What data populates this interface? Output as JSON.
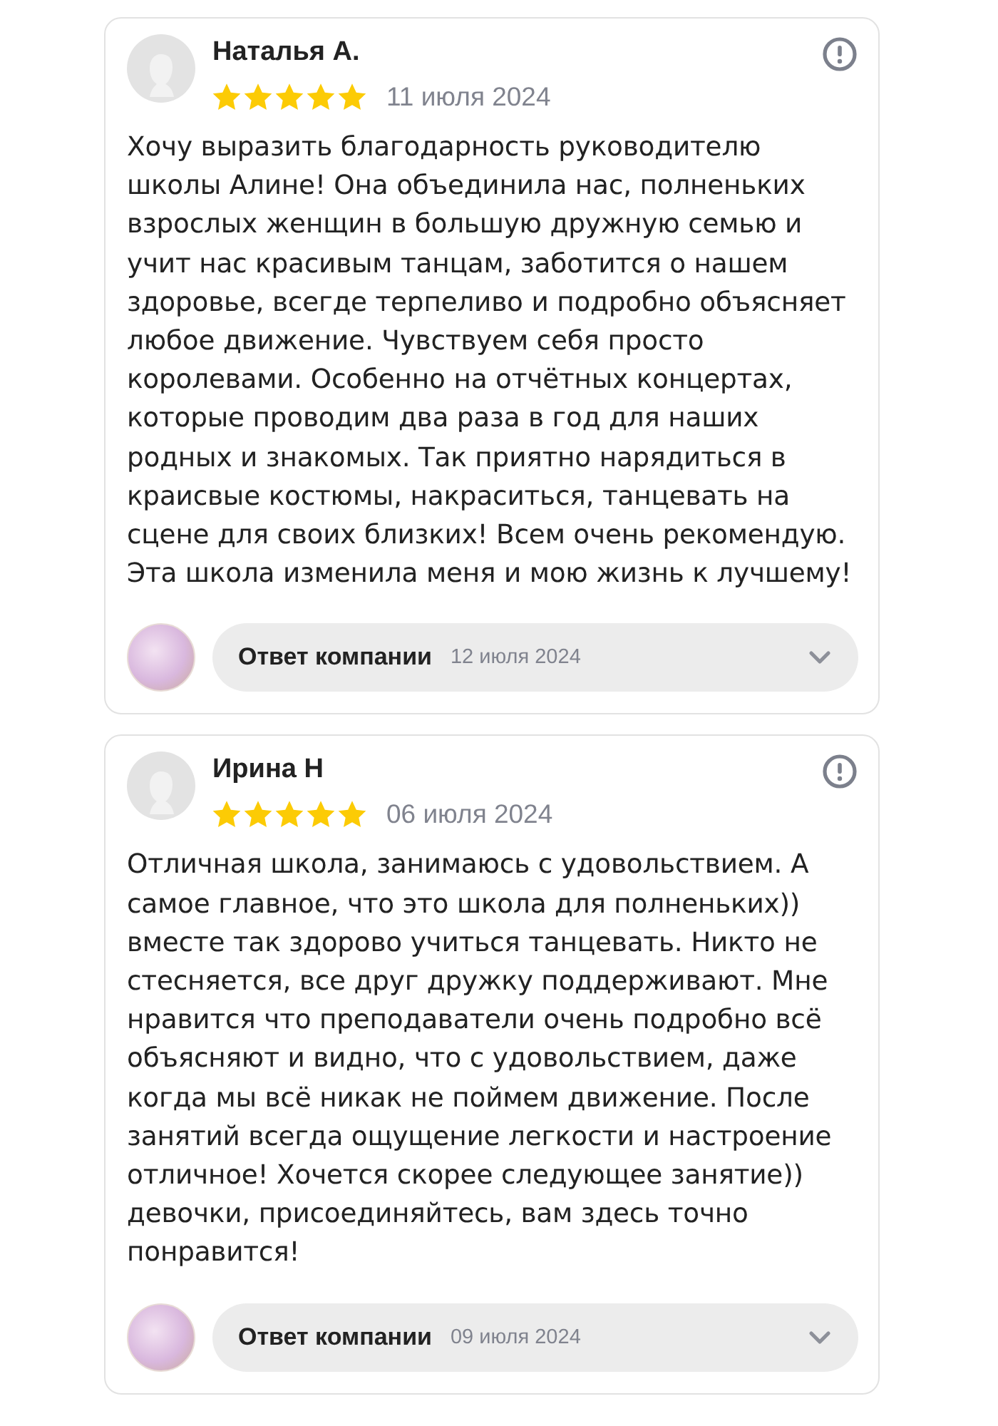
{
  "reviews": [
    {
      "author": "Наталья А.",
      "stars": 5,
      "date": "11 июля 2024",
      "text": "Хочу выразить благодарность руководителю школы Алине! Она объединила нас, полненьких взрослых женщин в большую дружную семью и учит нас красивым танцам, заботится о нашем здоровье, всегде терпеливо и подробно объясняет любое движение. Чувствуем себя просто королевами. Особенно на отчётных концертах, которые проводим два раза в год для наших родных и знакомых. Так приятно нарядиться в краисвые костюмы, накраситься, танцевать на сцене для своих близких! Всем очень рекомендую. Эта школа изменила меня и мою жизнь к лучшему!",
      "reply": {
        "label": "Ответ компании",
        "date": "12 июля 2024",
        "expanded": false
      }
    },
    {
      "author": "Ирина Н",
      "stars": 5,
      "date": "06 июля 2024",
      "text": "Отличная школа, занимаюсь с удовольствием. А самое главное, что это школа для полненьких)) вместе так здорово учиться танцевать. Никто не стесняется, все друг дружку поддерживают. Мне нравится что преподаватели очень подробно всё объясняют и видно, что с удовольствием, даже когда мы всё никак не поймем движение. После занятий всегда ощущение легкости и настроение отличное! Хочется скорее следующее занятие)) девочки, присоединяйтесь, вам здесь точно понравится!",
      "reply": {
        "label": "Ответ компании",
        "date": "09 июля 2024",
        "expanded": false
      }
    }
  ]
}
